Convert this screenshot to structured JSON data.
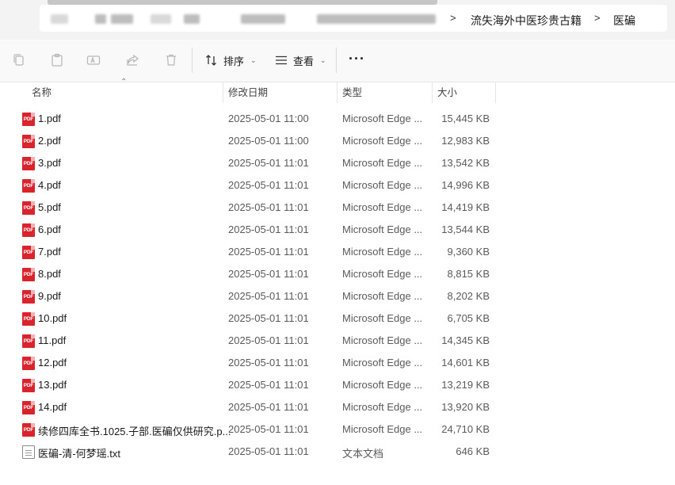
{
  "address_bar": {
    "breadcrumbs": [
      "流失海外中医珍贵古籍",
      "医碥"
    ],
    "separator": ">"
  },
  "toolbar": {
    "sort_label": "排序",
    "view_label": "查看",
    "more_label": "···"
  },
  "columns": {
    "name": "名称",
    "modified": "修改日期",
    "type": "类型",
    "size": "大小"
  },
  "files": [
    {
      "name": "1.pdf",
      "modified": "2025-05-01 11:00",
      "type": "Microsoft Edge ...",
      "size": "15,445 KB",
      "icon": "pdf-icon"
    },
    {
      "name": "2.pdf",
      "modified": "2025-05-01 11:00",
      "type": "Microsoft Edge ...",
      "size": "12,983 KB",
      "icon": "pdf-icon"
    },
    {
      "name": "3.pdf",
      "modified": "2025-05-01 11:01",
      "type": "Microsoft Edge ...",
      "size": "13,542 KB",
      "icon": "pdf-icon"
    },
    {
      "name": "4.pdf",
      "modified": "2025-05-01 11:01",
      "type": "Microsoft Edge ...",
      "size": "14,996 KB",
      "icon": "pdf-icon"
    },
    {
      "name": "5.pdf",
      "modified": "2025-05-01 11:01",
      "type": "Microsoft Edge ...",
      "size": "14,419 KB",
      "icon": "pdf-icon"
    },
    {
      "name": "6.pdf",
      "modified": "2025-05-01 11:01",
      "type": "Microsoft Edge ...",
      "size": "13,544 KB",
      "icon": "pdf-icon"
    },
    {
      "name": "7.pdf",
      "modified": "2025-05-01 11:01",
      "type": "Microsoft Edge ...",
      "size": "9,360 KB",
      "icon": "pdf-icon"
    },
    {
      "name": "8.pdf",
      "modified": "2025-05-01 11:01",
      "type": "Microsoft Edge ...",
      "size": "8,815 KB",
      "icon": "pdf-icon"
    },
    {
      "name": "9.pdf",
      "modified": "2025-05-01 11:01",
      "type": "Microsoft Edge ...",
      "size": "8,202 KB",
      "icon": "pdf-icon"
    },
    {
      "name": "10.pdf",
      "modified": "2025-05-01 11:01",
      "type": "Microsoft Edge ...",
      "size": "6,705 KB",
      "icon": "pdf-icon"
    },
    {
      "name": "11.pdf",
      "modified": "2025-05-01 11:01",
      "type": "Microsoft Edge ...",
      "size": "14,345 KB",
      "icon": "pdf-icon"
    },
    {
      "name": "12.pdf",
      "modified": "2025-05-01 11:01",
      "type": "Microsoft Edge ...",
      "size": "14,601 KB",
      "icon": "pdf-icon"
    },
    {
      "name": "13.pdf",
      "modified": "2025-05-01 11:01",
      "type": "Microsoft Edge ...",
      "size": "13,219 KB",
      "icon": "pdf-icon"
    },
    {
      "name": "14.pdf",
      "modified": "2025-05-01 11:01",
      "type": "Microsoft Edge ...",
      "size": "13,920 KB",
      "icon": "pdf-icon"
    },
    {
      "name": "续修四库全书.1025.子部.医碥仅供研究.p...",
      "modified": "2025-05-01 11:01",
      "type": "Microsoft Edge ...",
      "size": "24,710 KB",
      "icon": "pdf-icon"
    },
    {
      "name": "医碥-清-何梦瑶.txt",
      "modified": "2025-05-01 11:01",
      "type": "文本文档",
      "size": "646 KB",
      "icon": "txt-icon"
    }
  ],
  "colors": {
    "pdf_red": "#d9232d",
    "toolbar_bg": "#f9f9f9",
    "address_bg": "#f3f3f3"
  }
}
